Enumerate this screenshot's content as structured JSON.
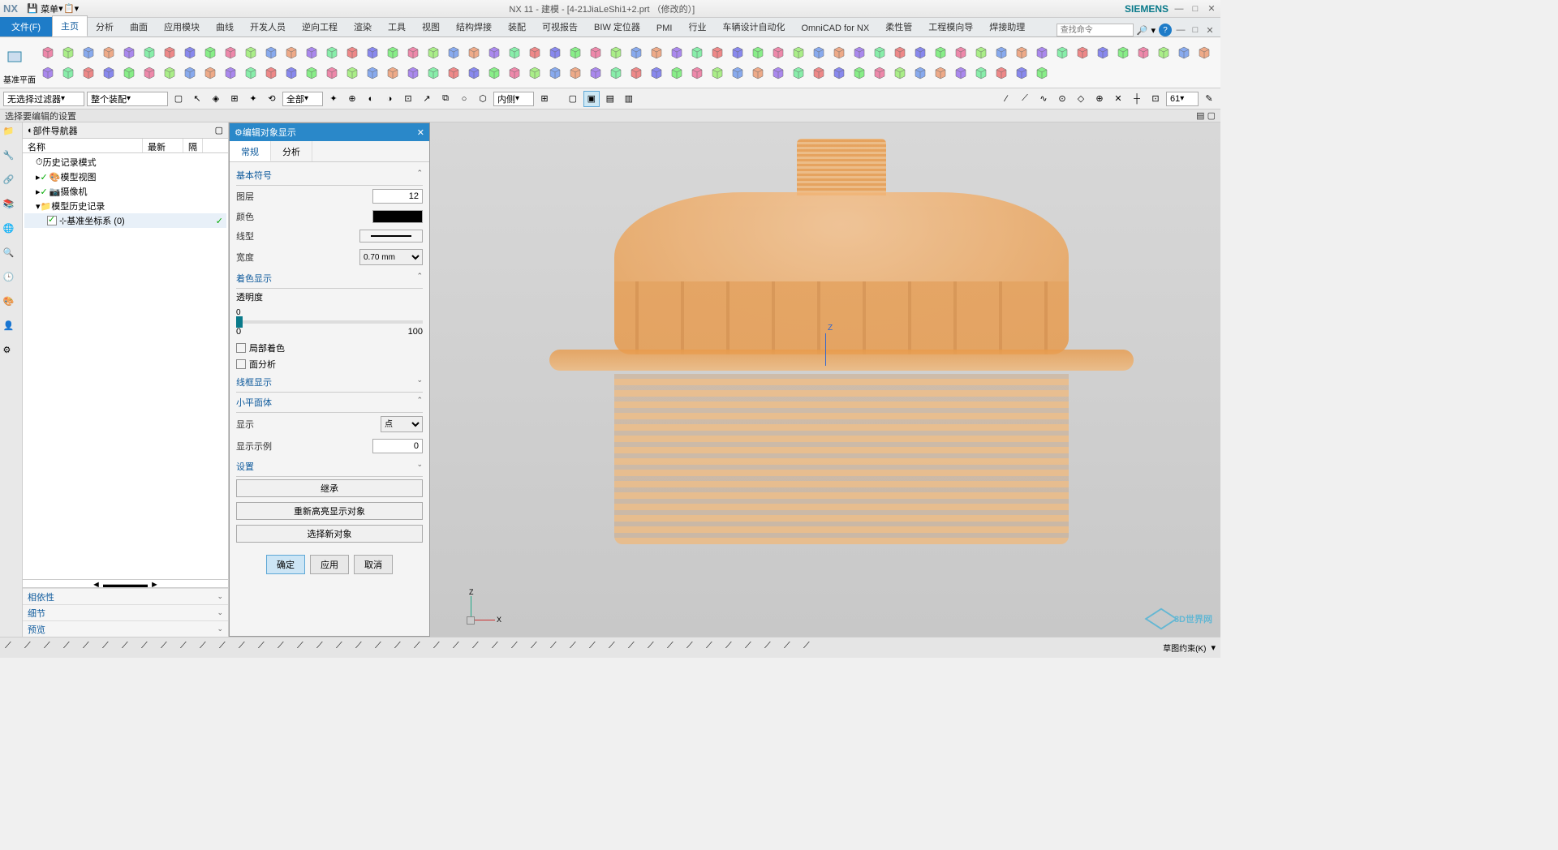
{
  "title": {
    "app": "NX 11",
    "mode": "建模",
    "file": "[4-21JiaLeShi1+2.prt （修改的）]",
    "brand": "SIEMENS",
    "nx": "NX",
    "menu": "菜单"
  },
  "ribbon": {
    "file": "文件(F)",
    "tabs": [
      "主页",
      "分析",
      "曲面",
      "应用模块",
      "曲线",
      "开发人员",
      "逆向工程",
      "渲染",
      "工具",
      "视图",
      "结构焊接",
      "装配",
      "可视报告",
      "BIW 定位器",
      "PMI",
      "行业",
      "车辆设计自动化",
      "OmniCAD for NX",
      "柔性管",
      "工程模向导",
      "焊接助理"
    ],
    "first_group": "基准平面"
  },
  "search": {
    "placeholder": "查找命令"
  },
  "toolbar2": {
    "filter1": "无选择过滤器",
    "filter2": "整个装配",
    "filter3": "全部",
    "filter4": "内侧",
    "spinbox": "61"
  },
  "hint": "选择要编辑的设置",
  "nav": {
    "title": "部件导航器",
    "col_name": "名称",
    "col_latest": "最新",
    "col_ext": "隔",
    "items": {
      "history_mode": "历史记录模式",
      "model_view": "模型视图",
      "camera": "摄像机",
      "model_history": "模型历史记录",
      "datum_csys": "基准坐标系 (0)"
    },
    "sections": [
      "相依性",
      "细节",
      "预览"
    ]
  },
  "dialog": {
    "title": "编辑对象显示",
    "tabs": [
      "常规",
      "分析"
    ],
    "sec_basic": "基本符号",
    "layer": "图层",
    "layer_val": "12",
    "color": "颜色",
    "linetype": "线型",
    "width": "宽度",
    "width_val": "0.70 mm",
    "sec_shade": "着色显示",
    "transparency": "透明度",
    "t0": "0",
    "t100": "100",
    "partial_shade": "局部着色",
    "face_analysis": "面分析",
    "sec_wireframe": "线框显示",
    "sec_facet": "小平面体",
    "display": "显示",
    "display_val": "点",
    "display_ex": "显示示例",
    "display_ex_val": "0",
    "sec_settings": "设置",
    "btn_inherit": "继承",
    "btn_rehighlight": "重新高亮显示对象",
    "btn_select_new": "选择新对象",
    "ok": "确定",
    "apply": "应用",
    "cancel": "取消"
  },
  "viewport": {
    "z": "Z",
    "x": "X"
  },
  "watermark": "3D世界网",
  "statusbar": {
    "right": "草图约束(K)"
  }
}
